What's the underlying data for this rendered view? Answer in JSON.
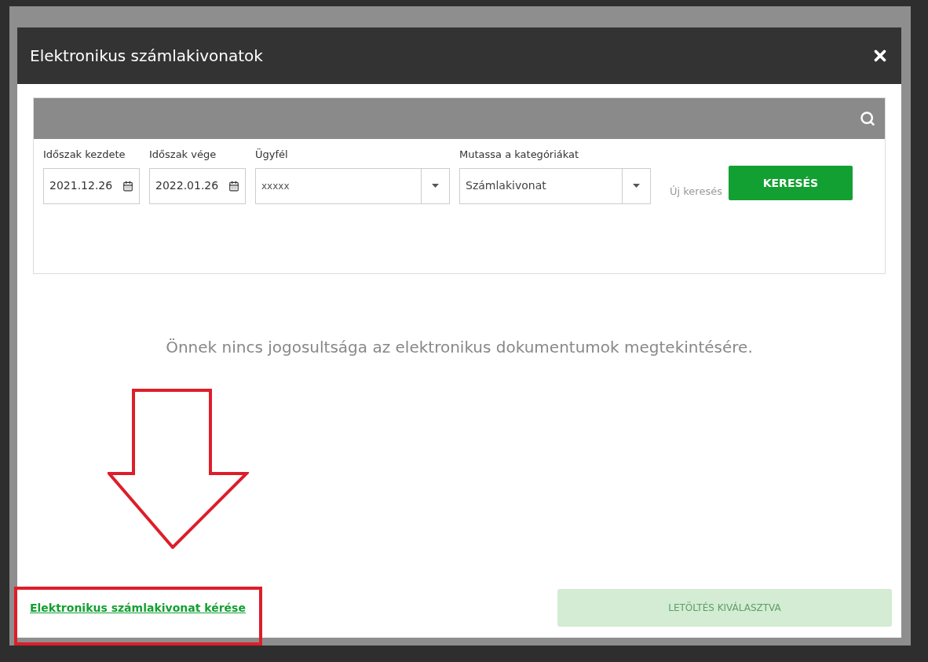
{
  "dialog": {
    "title": "Elektronikus számlakivonatok"
  },
  "filters": [
    {
      "kind": "date",
      "label": "Időszak kezdete",
      "value": "2021.12.26"
    },
    {
      "kind": "date",
      "label": "Időszak vége",
      "value": "2022.01.26"
    },
    {
      "kind": "select",
      "label": "Ügyfél",
      "value": "xxxxx"
    },
    {
      "kind": "select",
      "label": "Mutassa a kategóriákat",
      "value": "Számlakivonat"
    }
  ],
  "new_search": "Új keresés",
  "search_button": "KERESÉS",
  "message": "Önnek nincs jogosultsága az elektronikus dokumentumok megtekintésére.",
  "request_link": "Elektronikus számlakivonat kérése",
  "download_button": {
    "label": "LETÖLTÉS KIVÁLASZTVA",
    "disabled": true
  }
}
